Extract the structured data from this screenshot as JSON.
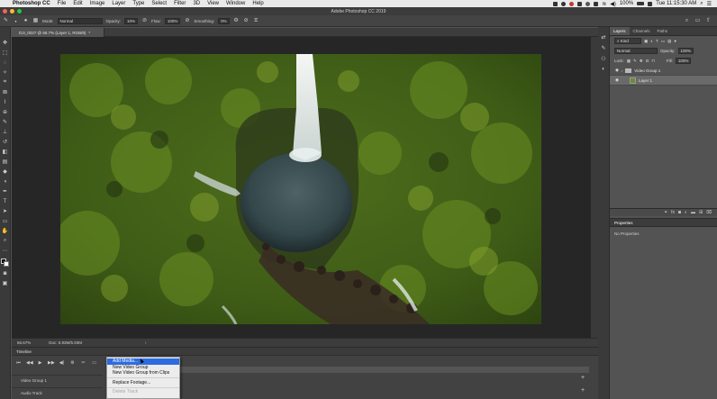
{
  "menubar": {
    "app_name": "Photoshop CC",
    "items": [
      "File",
      "Edit",
      "Image",
      "Layer",
      "Type",
      "Select",
      "Filter",
      "3D",
      "View",
      "Window",
      "Help"
    ],
    "battery": "100%",
    "clock": "Tue 11:15:30 AM"
  },
  "window": {
    "title": "Adobe Photoshop CC 2019"
  },
  "options_bar": {
    "mode_label": "Mode:",
    "mode_value": "Normal",
    "opacity_label": "Opacity:",
    "opacity_value": "10%",
    "flow_label": "Flow:",
    "flow_value": "100%",
    "smoothing_label": "Smoothing:",
    "smoothing_value": "0%"
  },
  "document": {
    "tab_label": "DJI_0027 @ 66.7% (Layer 1, RGB/8)",
    "tab_marker": "*"
  },
  "status": {
    "zoom": "66.67%",
    "doc_size": "Doc: 5.93M/5.93M"
  },
  "timeline": {
    "title": "Timeline",
    "tracks": [
      "Video Group 1",
      "Audio Track"
    ]
  },
  "context_menu": {
    "items": [
      {
        "label": "Add Media...",
        "state": "highlighted"
      },
      {
        "label": "New Video Group",
        "state": "normal"
      },
      {
        "label": "New Video Group from Clips",
        "state": "normal"
      },
      {
        "label": "Replace Footage...",
        "state": "normal"
      },
      {
        "label": "Delete Track",
        "state": "disabled"
      }
    ]
  },
  "layers_panel": {
    "tabs": [
      "Layers",
      "Channels",
      "Paths"
    ],
    "filter_kind": "Kind",
    "blend_mode": "Normal",
    "opacity_label": "Opacity:",
    "opacity_value": "100%",
    "lock_label": "Lock:",
    "fill_label": "Fill:",
    "fill_value": "100%",
    "layers": [
      {
        "name": "Video Group 1",
        "type": "group",
        "selected": false
      },
      {
        "name": "Layer 1",
        "type": "layer",
        "selected": true
      }
    ]
  },
  "properties_panel": {
    "title": "Properties",
    "body": "No Properties"
  },
  "colors": {
    "highlight": "#2d6ce0",
    "close": "#fc5f57",
    "minimize": "#fdbc2e",
    "zoom": "#28c840"
  }
}
